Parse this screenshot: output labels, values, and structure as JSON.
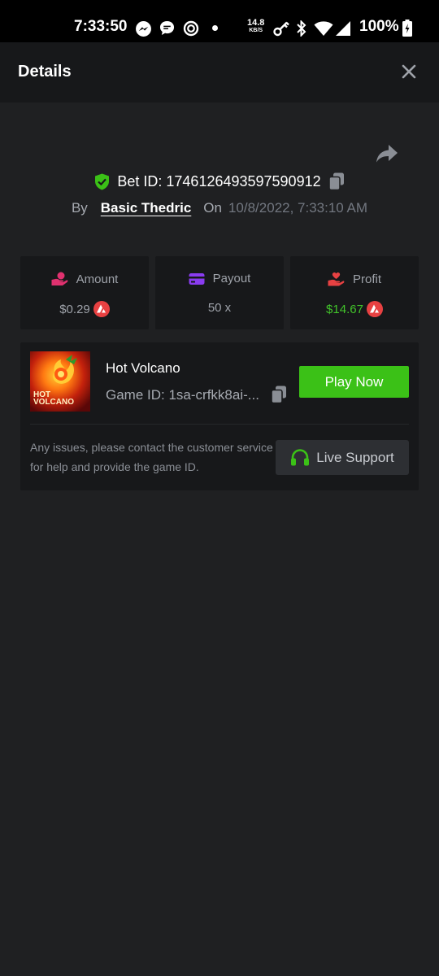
{
  "status_bar": {
    "time": "7:33:50",
    "net_speed": "14.8",
    "net_unit": "KB/S",
    "battery": "100%"
  },
  "header": {
    "title": "Details"
  },
  "bet": {
    "id_label": "Bet ID: 1746126493597590912",
    "by_label": "By",
    "user": "Basic Thedric",
    "on_label": "On",
    "date": "10/8/2022, 7:33:10 AM"
  },
  "stats": {
    "amount": {
      "label": "Amount",
      "value": "$0.29"
    },
    "payout": {
      "label": "Payout",
      "value": "50 x"
    },
    "profit": {
      "label": "Profit",
      "value": "$14.67"
    }
  },
  "game": {
    "name": "Hot Volcano",
    "id": "Game ID: 1sa-crfkk8ai-...",
    "play_label": "Play Now",
    "notice": "Any issues, please contact the customer service for help and provide the game ID.",
    "support_label": "Live Support",
    "thumb_text_1": "HOT",
    "thumb_text_2": "VOLCANO"
  },
  "colors": {
    "accent_green": "#3bc117",
    "profit_green": "#42c52a",
    "avax_red": "#e84142",
    "amount_icon": "#e0316f",
    "payout_icon": "#8a3cf0"
  },
  "icons": {
    "amount": "hand-coins-icon",
    "payout": "card-icon",
    "profit": "hand-heart-icon",
    "currency": "avalanche-icon",
    "verified": "shield-check-icon",
    "share": "share-arrow-icon",
    "copy": "copy-icon",
    "support": "headset-icon"
  }
}
